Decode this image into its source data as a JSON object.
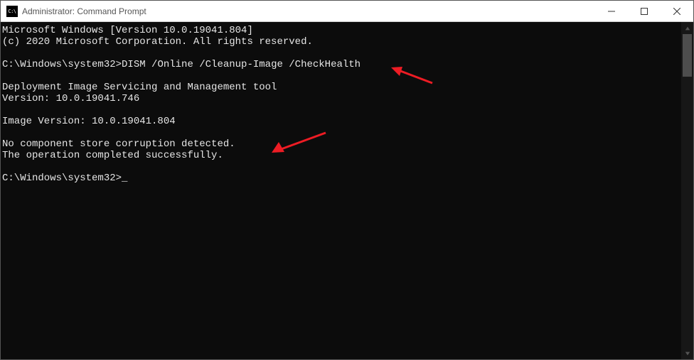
{
  "window": {
    "title": "Administrator: Command Prompt"
  },
  "terminal": {
    "line1": "Microsoft Windows [Version 10.0.19041.804]",
    "line2": "(c) 2020 Microsoft Corporation. All rights reserved.",
    "blank1": "",
    "prompt1_prefix": "C:\\Windows\\system32>",
    "prompt1_cmd": "DISM /Online /Cleanup-Image /CheckHealth",
    "blank2": "",
    "out1": "Deployment Image Servicing and Management tool",
    "out2": "Version: 10.0.19041.746",
    "blank3": "",
    "out3": "Image Version: 10.0.19041.804",
    "blank4": "",
    "out4": "No component store corruption detected.",
    "out5": "The operation completed successfully.",
    "blank5": "",
    "prompt2_prefix": "C:\\Windows\\system32>",
    "cursor": "_"
  }
}
